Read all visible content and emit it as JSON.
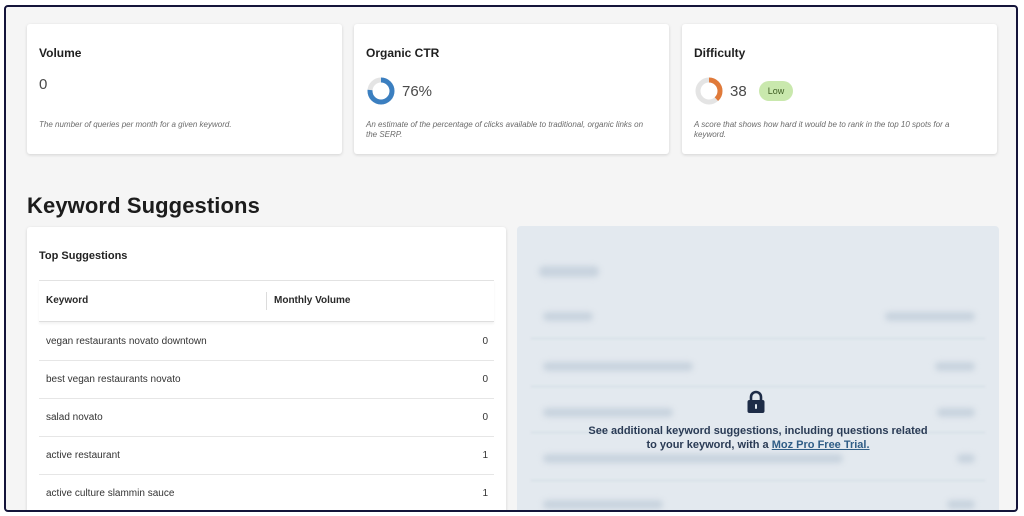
{
  "metrics": {
    "volume": {
      "title": "Volume",
      "value": "0",
      "description": "The number of queries per month for a given keyword."
    },
    "ctr": {
      "title": "Organic CTR",
      "value": "76%",
      "fraction": 0.76,
      "color": "#3b7fc0",
      "description": "An estimate of the percentage of clicks available to traditional, organic links on the SERP."
    },
    "difficulty": {
      "title": "Difficulty",
      "value": "38",
      "fraction": 0.38,
      "color": "#e07a3a",
      "badge": "Low",
      "description": "A score that shows how hard it would be to rank in the top 10 spots for a keyword."
    }
  },
  "suggestions": {
    "heading": "Keyword Suggestions",
    "panel_title": "Top Suggestions",
    "columns": {
      "keyword": "Keyword",
      "volume": "Monthly Volume"
    },
    "rows": [
      {
        "keyword": "vegan restaurants novato downtown",
        "volume": "0"
      },
      {
        "keyword": "best vegan restaurants novato",
        "volume": "0"
      },
      {
        "keyword": "salad novato",
        "volume": "0"
      },
      {
        "keyword": "active restaurant",
        "volume": "1"
      },
      {
        "keyword": "active culture slammin sauce",
        "volume": "1"
      }
    ]
  },
  "locked": {
    "message_line1": "See additional keyword suggestions, including questions related",
    "message_line2_prefix": "to your keyword, with a ",
    "link_text": "Moz Pro Free Trial.",
    "icon": "lock-icon"
  }
}
